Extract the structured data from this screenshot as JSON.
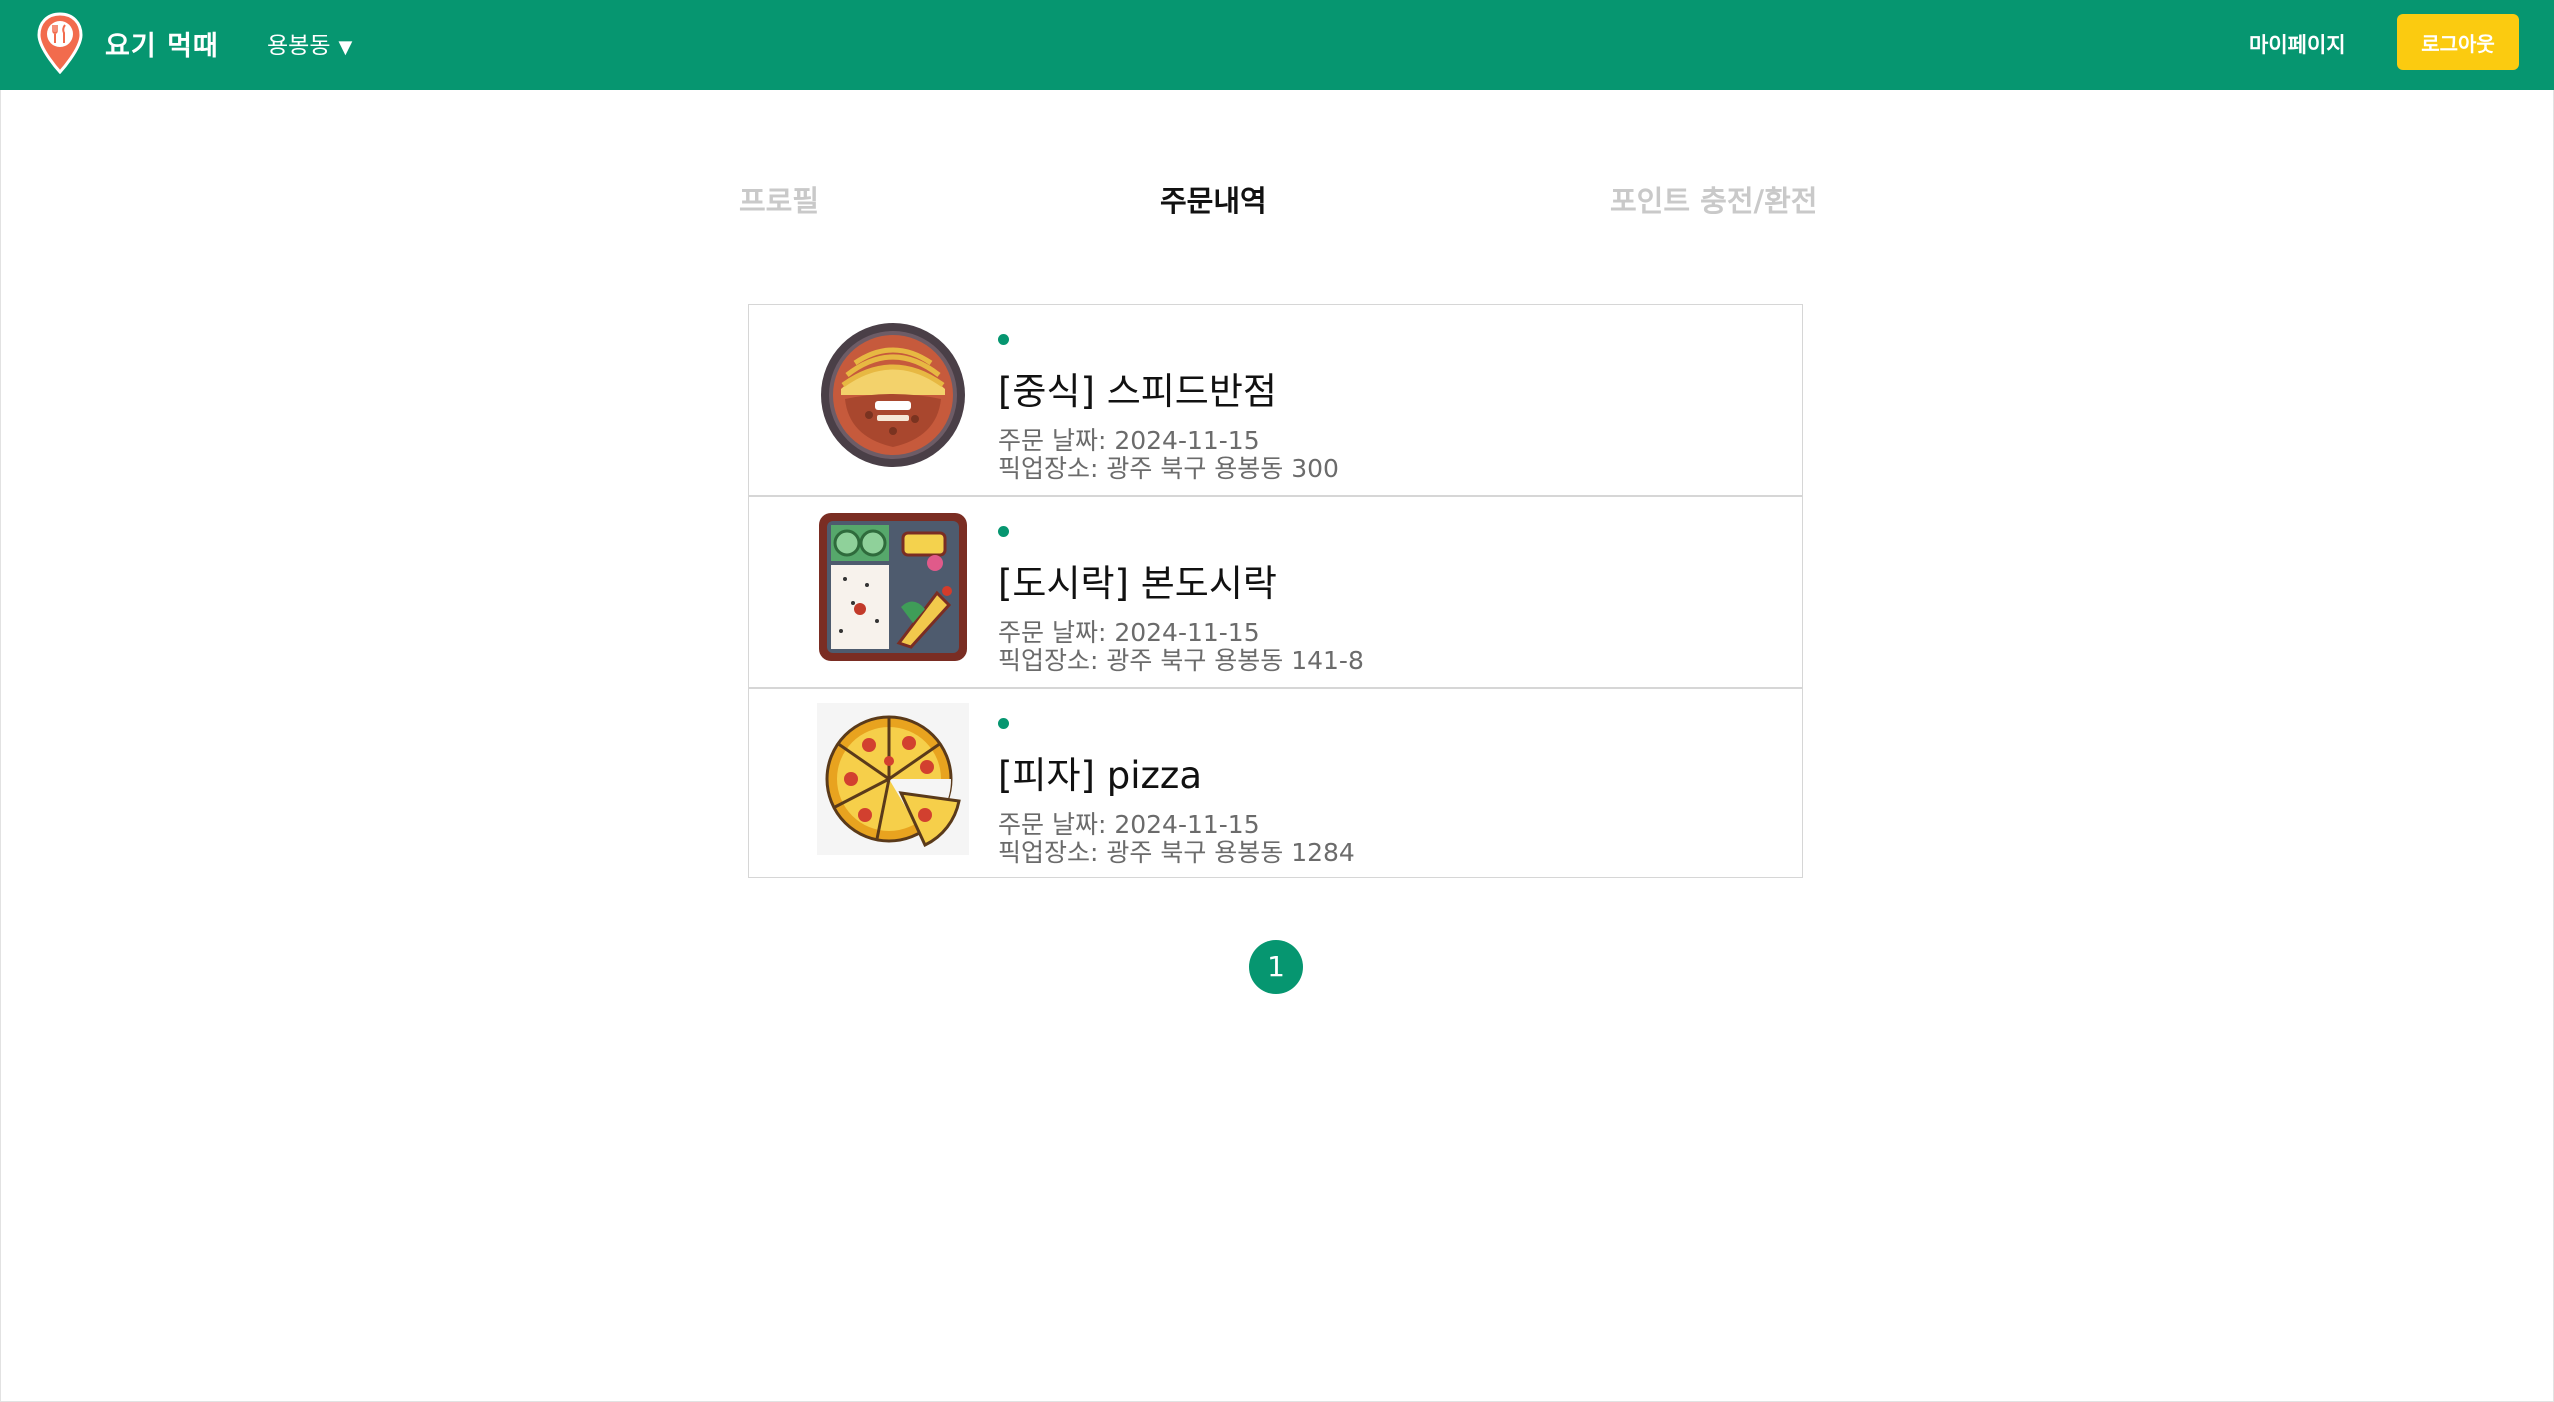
{
  "header": {
    "brand": "요기 먹때",
    "location": "용봉동",
    "mypage_label": "마이페이지",
    "logout_label": "로그아웃",
    "brand_color": "#069670",
    "logout_color": "#fbcb10"
  },
  "tabs": [
    {
      "label": "프로필",
      "active": false
    },
    {
      "label": "주문내역",
      "active": true
    },
    {
      "label": "포인트 충전/환전",
      "active": false
    }
  ],
  "orders": [
    {
      "icon": "jjajangmyeon-icon",
      "name": "[중식] 스피드반점",
      "date": "주문 날짜: 2024-11-15",
      "pickup": "픽업장소: 광주 북구 용봉동 300"
    },
    {
      "icon": "lunchbox-icon",
      "name": "[도시락] 본도시락",
      "date": "주문 날짜: 2024-11-15",
      "pickup": "픽업장소: 광주 북구 용봉동 141-8"
    },
    {
      "icon": "pizza-icon",
      "name": "[피자] pizza",
      "date": "주문 날짜: 2024-11-15",
      "pickup": "픽업장소: 광주 북구 용봉동 1284"
    }
  ],
  "pagination": {
    "current_page": "1"
  }
}
